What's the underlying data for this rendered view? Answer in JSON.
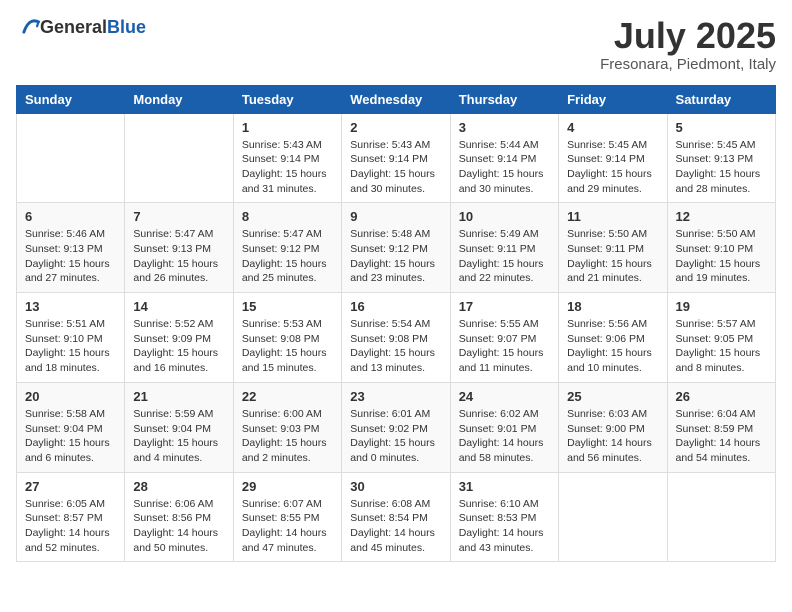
{
  "logo": {
    "general": "General",
    "blue": "Blue"
  },
  "title": {
    "month_year": "July 2025",
    "location": "Fresonara, Piedmont, Italy"
  },
  "headers": [
    "Sunday",
    "Monday",
    "Tuesday",
    "Wednesday",
    "Thursday",
    "Friday",
    "Saturday"
  ],
  "weeks": [
    [
      {
        "day": "",
        "info": ""
      },
      {
        "day": "",
        "info": ""
      },
      {
        "day": "1",
        "info": "Sunrise: 5:43 AM\nSunset: 9:14 PM\nDaylight: 15 hours\nand 31 minutes."
      },
      {
        "day": "2",
        "info": "Sunrise: 5:43 AM\nSunset: 9:14 PM\nDaylight: 15 hours\nand 30 minutes."
      },
      {
        "day": "3",
        "info": "Sunrise: 5:44 AM\nSunset: 9:14 PM\nDaylight: 15 hours\nand 30 minutes."
      },
      {
        "day": "4",
        "info": "Sunrise: 5:45 AM\nSunset: 9:14 PM\nDaylight: 15 hours\nand 29 minutes."
      },
      {
        "day": "5",
        "info": "Sunrise: 5:45 AM\nSunset: 9:13 PM\nDaylight: 15 hours\nand 28 minutes."
      }
    ],
    [
      {
        "day": "6",
        "info": "Sunrise: 5:46 AM\nSunset: 9:13 PM\nDaylight: 15 hours\nand 27 minutes."
      },
      {
        "day": "7",
        "info": "Sunrise: 5:47 AM\nSunset: 9:13 PM\nDaylight: 15 hours\nand 26 minutes."
      },
      {
        "day": "8",
        "info": "Sunrise: 5:47 AM\nSunset: 9:12 PM\nDaylight: 15 hours\nand 25 minutes."
      },
      {
        "day": "9",
        "info": "Sunrise: 5:48 AM\nSunset: 9:12 PM\nDaylight: 15 hours\nand 23 minutes."
      },
      {
        "day": "10",
        "info": "Sunrise: 5:49 AM\nSunset: 9:11 PM\nDaylight: 15 hours\nand 22 minutes."
      },
      {
        "day": "11",
        "info": "Sunrise: 5:50 AM\nSunset: 9:11 PM\nDaylight: 15 hours\nand 21 minutes."
      },
      {
        "day": "12",
        "info": "Sunrise: 5:50 AM\nSunset: 9:10 PM\nDaylight: 15 hours\nand 19 minutes."
      }
    ],
    [
      {
        "day": "13",
        "info": "Sunrise: 5:51 AM\nSunset: 9:10 PM\nDaylight: 15 hours\nand 18 minutes."
      },
      {
        "day": "14",
        "info": "Sunrise: 5:52 AM\nSunset: 9:09 PM\nDaylight: 15 hours\nand 16 minutes."
      },
      {
        "day": "15",
        "info": "Sunrise: 5:53 AM\nSunset: 9:08 PM\nDaylight: 15 hours\nand 15 minutes."
      },
      {
        "day": "16",
        "info": "Sunrise: 5:54 AM\nSunset: 9:08 PM\nDaylight: 15 hours\nand 13 minutes."
      },
      {
        "day": "17",
        "info": "Sunrise: 5:55 AM\nSunset: 9:07 PM\nDaylight: 15 hours\nand 11 minutes."
      },
      {
        "day": "18",
        "info": "Sunrise: 5:56 AM\nSunset: 9:06 PM\nDaylight: 15 hours\nand 10 minutes."
      },
      {
        "day": "19",
        "info": "Sunrise: 5:57 AM\nSunset: 9:05 PM\nDaylight: 15 hours\nand 8 minutes."
      }
    ],
    [
      {
        "day": "20",
        "info": "Sunrise: 5:58 AM\nSunset: 9:04 PM\nDaylight: 15 hours\nand 6 minutes."
      },
      {
        "day": "21",
        "info": "Sunrise: 5:59 AM\nSunset: 9:04 PM\nDaylight: 15 hours\nand 4 minutes."
      },
      {
        "day": "22",
        "info": "Sunrise: 6:00 AM\nSunset: 9:03 PM\nDaylight: 15 hours\nand 2 minutes."
      },
      {
        "day": "23",
        "info": "Sunrise: 6:01 AM\nSunset: 9:02 PM\nDaylight: 15 hours\nand 0 minutes."
      },
      {
        "day": "24",
        "info": "Sunrise: 6:02 AM\nSunset: 9:01 PM\nDaylight: 14 hours\nand 58 minutes."
      },
      {
        "day": "25",
        "info": "Sunrise: 6:03 AM\nSunset: 9:00 PM\nDaylight: 14 hours\nand 56 minutes."
      },
      {
        "day": "26",
        "info": "Sunrise: 6:04 AM\nSunset: 8:59 PM\nDaylight: 14 hours\nand 54 minutes."
      }
    ],
    [
      {
        "day": "27",
        "info": "Sunrise: 6:05 AM\nSunset: 8:57 PM\nDaylight: 14 hours\nand 52 minutes."
      },
      {
        "day": "28",
        "info": "Sunrise: 6:06 AM\nSunset: 8:56 PM\nDaylight: 14 hours\nand 50 minutes."
      },
      {
        "day": "29",
        "info": "Sunrise: 6:07 AM\nSunset: 8:55 PM\nDaylight: 14 hours\nand 47 minutes."
      },
      {
        "day": "30",
        "info": "Sunrise: 6:08 AM\nSunset: 8:54 PM\nDaylight: 14 hours\nand 45 minutes."
      },
      {
        "day": "31",
        "info": "Sunrise: 6:10 AM\nSunset: 8:53 PM\nDaylight: 14 hours\nand 43 minutes."
      },
      {
        "day": "",
        "info": ""
      },
      {
        "day": "",
        "info": ""
      }
    ]
  ]
}
